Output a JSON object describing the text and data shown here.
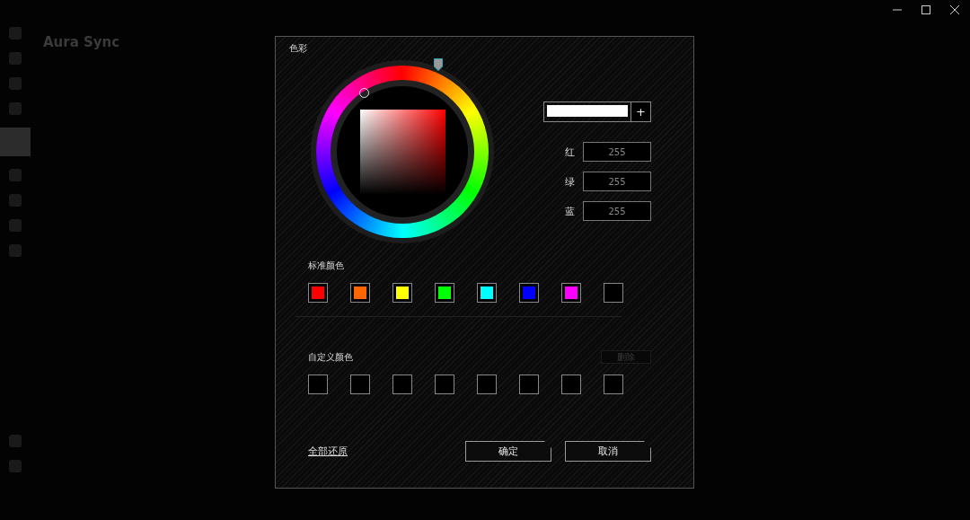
{
  "app": {
    "title": "Aura Sync",
    "sidebar": [
      {
        "selected": false
      },
      {
        "selected": false
      },
      {
        "selected": false
      },
      {
        "selected": false
      },
      {
        "selected": true
      },
      {
        "selected": false
      },
      {
        "selected": false
      },
      {
        "selected": false
      },
      {
        "selected": false
      },
      {
        "selected": false
      },
      {
        "selected": false
      }
    ]
  },
  "dialog": {
    "title": "色彩",
    "rgb": [
      {
        "label": "红",
        "value": "255"
      },
      {
        "label": "绿",
        "value": "255"
      },
      {
        "label": "蓝",
        "value": "255"
      }
    ],
    "add_button": "+",
    "standard_label": "标准颜色",
    "standard_colors": [
      {
        "kind": "swatch",
        "color": "#ff0000"
      },
      {
        "kind": "swatch",
        "color": "#ff6600"
      },
      {
        "kind": "swatch",
        "color": "#ffff00"
      },
      {
        "kind": "swatch",
        "color": "#00ff00"
      },
      {
        "kind": "swatch",
        "color": "#00ffff"
      },
      {
        "kind": "swatch",
        "color": "#0000ff"
      },
      {
        "kind": "swatch",
        "color": "#ff00ff"
      },
      {
        "kind": "empty"
      }
    ],
    "custom_label": "自定义颜色",
    "delete_button": {
      "label": "删除",
      "disabled": true
    },
    "custom_colors": [
      {
        "kind": "empty"
      },
      {
        "kind": "empty"
      },
      {
        "kind": "empty"
      },
      {
        "kind": "empty"
      },
      {
        "kind": "empty"
      },
      {
        "kind": "empty"
      },
      {
        "kind": "empty"
      },
      {
        "kind": "empty"
      }
    ],
    "reset_link": "全部还原",
    "buttons": [
      "确定",
      "取消"
    ]
  }
}
